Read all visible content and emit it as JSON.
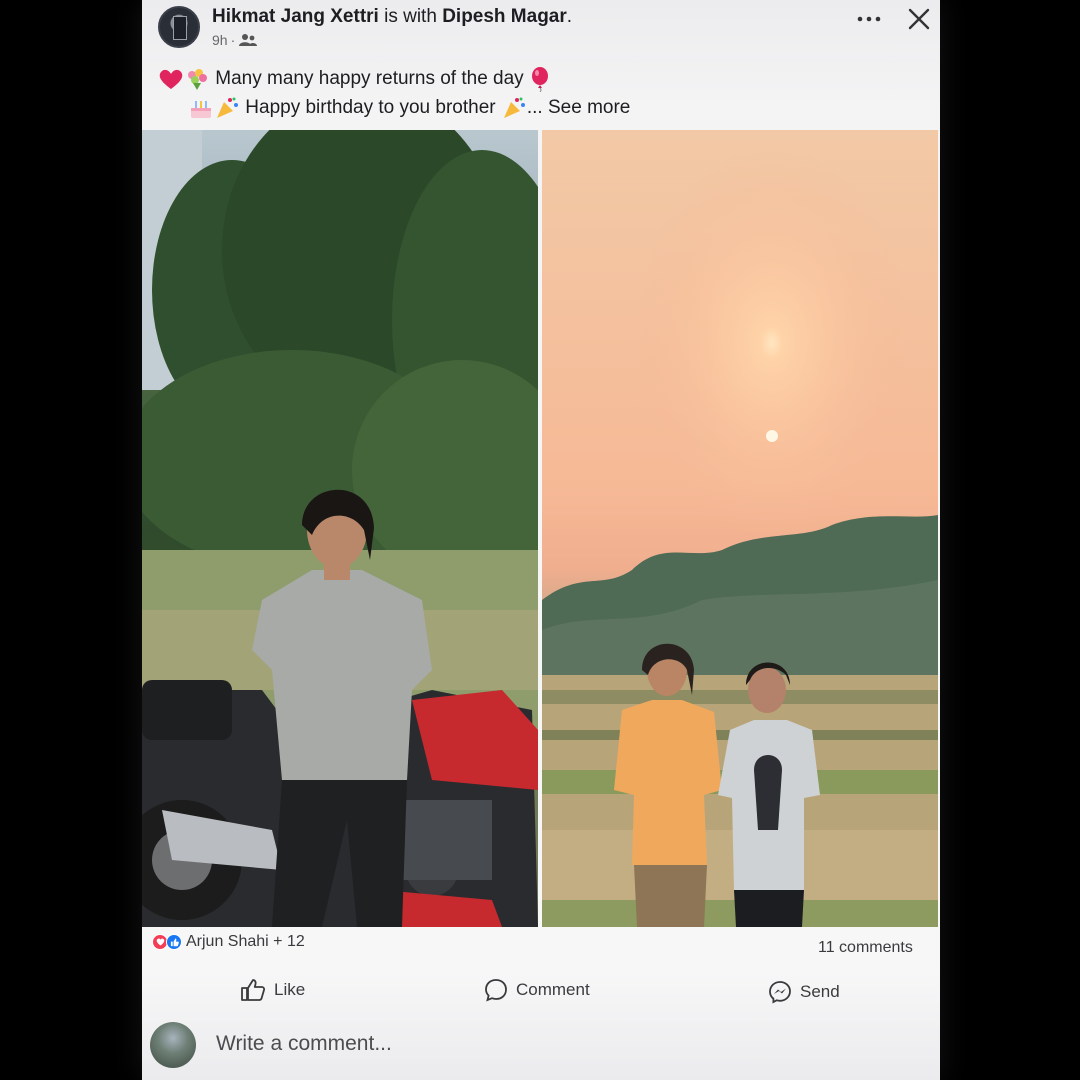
{
  "post": {
    "author": "Hikmat Jang Xettri",
    "with_text": "is with",
    "tagged": "Dipesh Magar",
    "period": ".",
    "time": "9h",
    "separator": "·",
    "privacy_icon": "friends-icon"
  },
  "caption": {
    "line1": "Many many happy returns of the day",
    "line2": "Happy birthday to you  brother",
    "ellipsis": "...",
    "see_more": "See more"
  },
  "header_actions": {
    "more": "more-options-icon",
    "close": "close-icon"
  },
  "reactions": {
    "label": "Arjun Shahi + 12",
    "types": [
      "love",
      "like"
    ]
  },
  "comments_count": "11 comments",
  "actions": {
    "like": "Like",
    "comment": "Comment",
    "send": "Send"
  },
  "composer": {
    "placeholder": "Write a comment..."
  },
  "colors": {
    "like_blue": "#1877f2",
    "love_red": "#f33e58",
    "balloon_red": "#e0245e"
  }
}
